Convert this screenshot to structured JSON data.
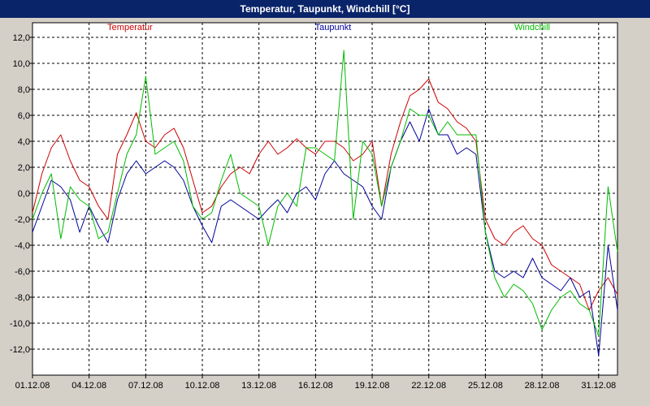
{
  "window": {
    "title": "Temperatur, Taupunkt, Windchill [°C]"
  },
  "chart_data": {
    "type": "line",
    "title": "Temperatur, Taupunkt, Windchill [°C]",
    "xlabel": "",
    "ylabel": "",
    "ylim": [
      -14,
      13
    ],
    "xlim": [
      0,
      31
    ],
    "grid": true,
    "legend_placement": "top",
    "y_ticks": [
      "12,0",
      "10,0",
      "8,0",
      "6,0",
      "4,0",
      "2,0",
      "0,0",
      "-2,0",
      "-4,0",
      "-6,0",
      "-8,0",
      "-10,0",
      "-12,0"
    ],
    "y_tick_values": [
      12,
      10,
      8,
      6,
      4,
      2,
      0,
      -2,
      -4,
      -6,
      -8,
      -10,
      -12
    ],
    "x_ticks": [
      "01.12.08",
      "04.12.08",
      "07.12.08",
      "10.12.08",
      "13.12.08",
      "16.12.08",
      "19.12.08",
      "22.12.08",
      "25.12.08",
      "28.12.08",
      "31.12.08"
    ],
    "x_tick_values": [
      0,
      3,
      6,
      9,
      12,
      15,
      18,
      21,
      24,
      27,
      30
    ],
    "x_unit": "days from 01.12.08",
    "series": [
      {
        "name": "Temperatur",
        "color": "#cc0000",
        "x": [
          0,
          0.5,
          1,
          1.5,
          2,
          2.5,
          3,
          3.5,
          4,
          4.5,
          5,
          5.5,
          6,
          6.5,
          7,
          7.5,
          8,
          8.5,
          9,
          9.5,
          10,
          10.5,
          11,
          11.5,
          12,
          12.5,
          13,
          13.5,
          14,
          14.5,
          15,
          15.5,
          16,
          16.5,
          17,
          17.5,
          18,
          18.5,
          19,
          19.5,
          20,
          20.5,
          21,
          21.5,
          22,
          22.5,
          23,
          23.5,
          24,
          24.5,
          25,
          25.5,
          26,
          26.5,
          27,
          27.5,
          28,
          28.5,
          29,
          29.5,
          30,
          30.5,
          31
        ],
        "values": [
          -1.5,
          1.5,
          3.5,
          4.5,
          2.5,
          1,
          0.5,
          -1,
          -2,
          3,
          4.5,
          6.2,
          4,
          3.5,
          4.5,
          5,
          3.5,
          1,
          -1.5,
          -1,
          0.5,
          1.5,
          2,
          1.5,
          3,
          4,
          3,
          3.5,
          4.2,
          3.5,
          3,
          4,
          4,
          3.5,
          2.5,
          3,
          4,
          -1,
          3,
          5.5,
          7.5,
          8,
          8.8,
          7,
          6.5,
          5.5,
          5,
          4,
          -2,
          -3.5,
          -4,
          -3,
          -2.5,
          -3.5,
          -4,
          -5.5,
          -6,
          -6.5,
          -7,
          -9,
          -7.5,
          -6.5,
          -7.8
        ]
      },
      {
        "name": "Taupunkt",
        "color": "#000099",
        "x": [
          0,
          0.5,
          1,
          1.5,
          2,
          2.5,
          3,
          3.5,
          4,
          4.5,
          5,
          5.5,
          6,
          6.5,
          7,
          7.5,
          8,
          8.5,
          9,
          9.5,
          10,
          10.5,
          11,
          11.5,
          12,
          12.5,
          13,
          13.5,
          14,
          14.5,
          15,
          15.5,
          16,
          16.5,
          17,
          17.5,
          18,
          18.5,
          19,
          19.5,
          20,
          20.5,
          21,
          21.5,
          22,
          22.5,
          23,
          23.5,
          24,
          24.5,
          25,
          25.5,
          26,
          26.5,
          27,
          27.5,
          28,
          28.5,
          29,
          29.5,
          30,
          30.5,
          31
        ],
        "values": [
          -3,
          -1,
          1,
          0.5,
          -0.5,
          -3,
          -1,
          -2.5,
          -3.8,
          -0.5,
          1.5,
          2.5,
          1.5,
          2,
          2.5,
          2,
          1,
          -1,
          -2.5,
          -3.8,
          -1,
          -0.5,
          -1,
          -1.5,
          -2,
          -1.2,
          -0.5,
          -1.5,
          0,
          0.5,
          -0.5,
          1.5,
          2.5,
          1.5,
          1,
          0.5,
          -1,
          -2,
          2,
          4,
          5.5,
          4,
          6.5,
          4.5,
          4.5,
          3,
          3.5,
          3,
          -3,
          -6,
          -6.5,
          -6,
          -6.5,
          -5,
          -6.5,
          -7,
          -7.5,
          -6.5,
          -8,
          -7.5,
          -12.5,
          -4,
          -9
        ]
      },
      {
        "name": "Windchill",
        "color": "#00bb00",
        "x": [
          0,
          0.5,
          1,
          1.5,
          2,
          2.5,
          3,
          3.5,
          4,
          4.5,
          5,
          5.5,
          6,
          6.5,
          7,
          7.5,
          8,
          8.5,
          9,
          9.5,
          10,
          10.5,
          11,
          11.5,
          12,
          12.5,
          13,
          13.5,
          14,
          14.5,
          15,
          15.5,
          16,
          16.5,
          17,
          17.5,
          18,
          18.5,
          19,
          19.5,
          20,
          20.5,
          21,
          21.5,
          22,
          22.5,
          23,
          23.5,
          24,
          24.5,
          25,
          25.5,
          26,
          26.5,
          27,
          27.5,
          28,
          28.5,
          29,
          29.5,
          30,
          30.5,
          31
        ],
        "values": [
          -2,
          0,
          1.5,
          -3.5,
          0.5,
          -0.5,
          -1,
          -3.5,
          -3,
          0,
          3,
          4.5,
          9,
          3,
          3.5,
          4,
          2.5,
          -1,
          -2,
          -1.5,
          1,
          3,
          0,
          -0.5,
          -1,
          -4,
          -1,
          0,
          -1,
          3.5,
          3.5,
          3,
          2.5,
          11,
          -2,
          4,
          3,
          -1,
          2,
          4,
          6.5,
          6,
          6,
          4.5,
          5.5,
          4.5,
          4.5,
          4.5,
          -3,
          -6.5,
          -8,
          -7,
          -7.5,
          -8.5,
          -10.5,
          -9,
          -8,
          -7.5,
          -8.5,
          -9,
          -11,
          0.5,
          -4.5
        ]
      }
    ]
  }
}
